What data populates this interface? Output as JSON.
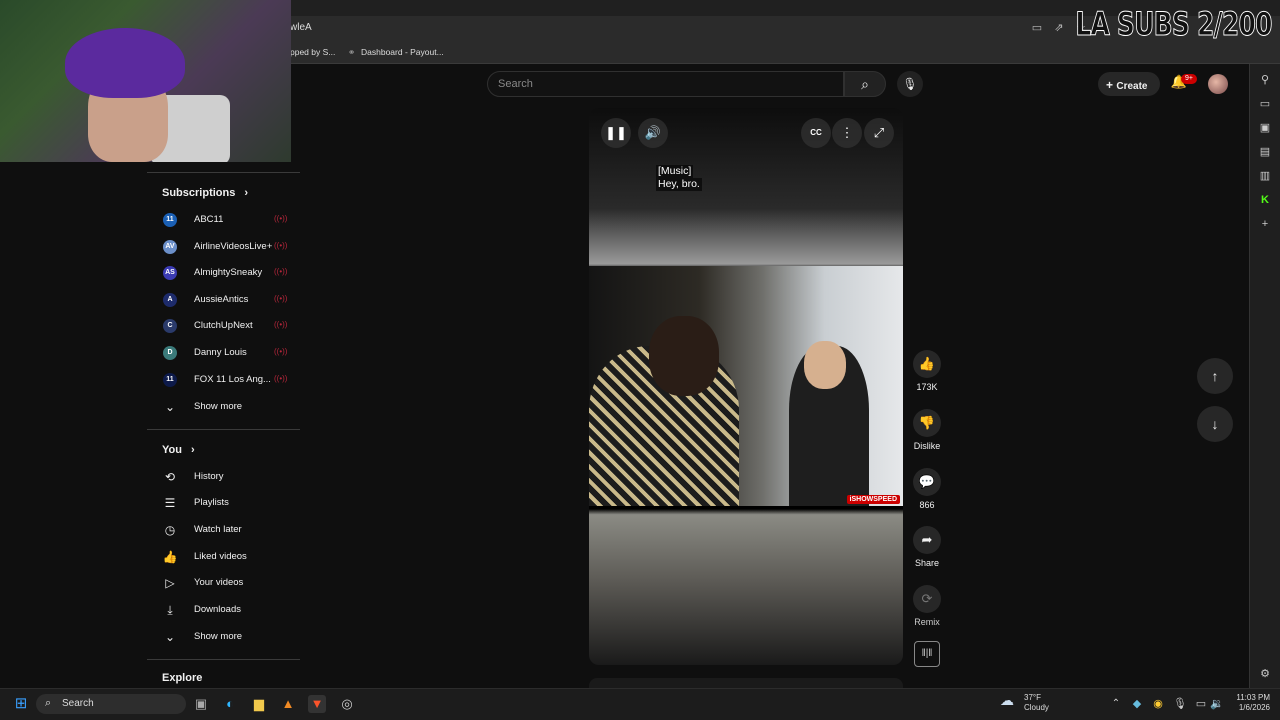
{
  "overlay": {
    "title": "LA SUBS 2/200"
  },
  "browser": {
    "address_fragment": "wleA",
    "bookmarks": [
      {
        "label": "pped by S..."
      },
      {
        "label": "Dashboard - Payout..."
      }
    ]
  },
  "header": {
    "search_placeholder": "Search",
    "create_label": "Create",
    "notification_count": "9+"
  },
  "sidebar": {
    "subscriptions_title": "Subscriptions",
    "channels": [
      {
        "name": "ABC11",
        "color": "#1a5fb4",
        "abbr": "11"
      },
      {
        "name": "AirlineVideosLive+",
        "color": "#6b8fc9",
        "abbr": "AV"
      },
      {
        "name": "AlmightySneaky",
        "color": "#3b3bb3",
        "abbr": "AS"
      },
      {
        "name": "AussieAntics",
        "color": "#1d2b6b",
        "abbr": "A"
      },
      {
        "name": "ClutchUpNext",
        "color": "#2a3a6a",
        "abbr": "C"
      },
      {
        "name": "Danny Louis",
        "color": "#3a7a7a",
        "abbr": "D"
      },
      {
        "name": "FOX 11 Los Ang...",
        "color": "#0d1a4a",
        "abbr": "11"
      }
    ],
    "subs_show_more": "Show more",
    "you_title": "You",
    "you_items": [
      {
        "label": "History",
        "icon": "history-icon",
        "glyph": "⟲"
      },
      {
        "label": "Playlists",
        "icon": "playlists-icon",
        "glyph": "☰"
      },
      {
        "label": "Watch later",
        "icon": "watch-later-icon",
        "glyph": "◷"
      },
      {
        "label": "Liked videos",
        "icon": "liked-videos-icon",
        "glyph": "👍"
      },
      {
        "label": "Your videos",
        "icon": "your-videos-icon",
        "glyph": "▷"
      },
      {
        "label": "Downloads",
        "icon": "downloads-icon",
        "glyph": "⤓"
      }
    ],
    "you_show_more": "Show more",
    "explore_title": "Explore"
  },
  "player": {
    "captions": [
      "[Music]",
      "Hey, bro."
    ],
    "watermark": "iSHOWSPEED"
  },
  "actions": {
    "likes": "173K",
    "dislike": "Dislike",
    "comments": "866",
    "share": "Share",
    "remix": "Remix"
  },
  "taskbar": {
    "search_label": "Search",
    "temperature": "37°F",
    "weather": "Cloudy",
    "time": "11:03 PM",
    "date": "1/6/2026"
  }
}
